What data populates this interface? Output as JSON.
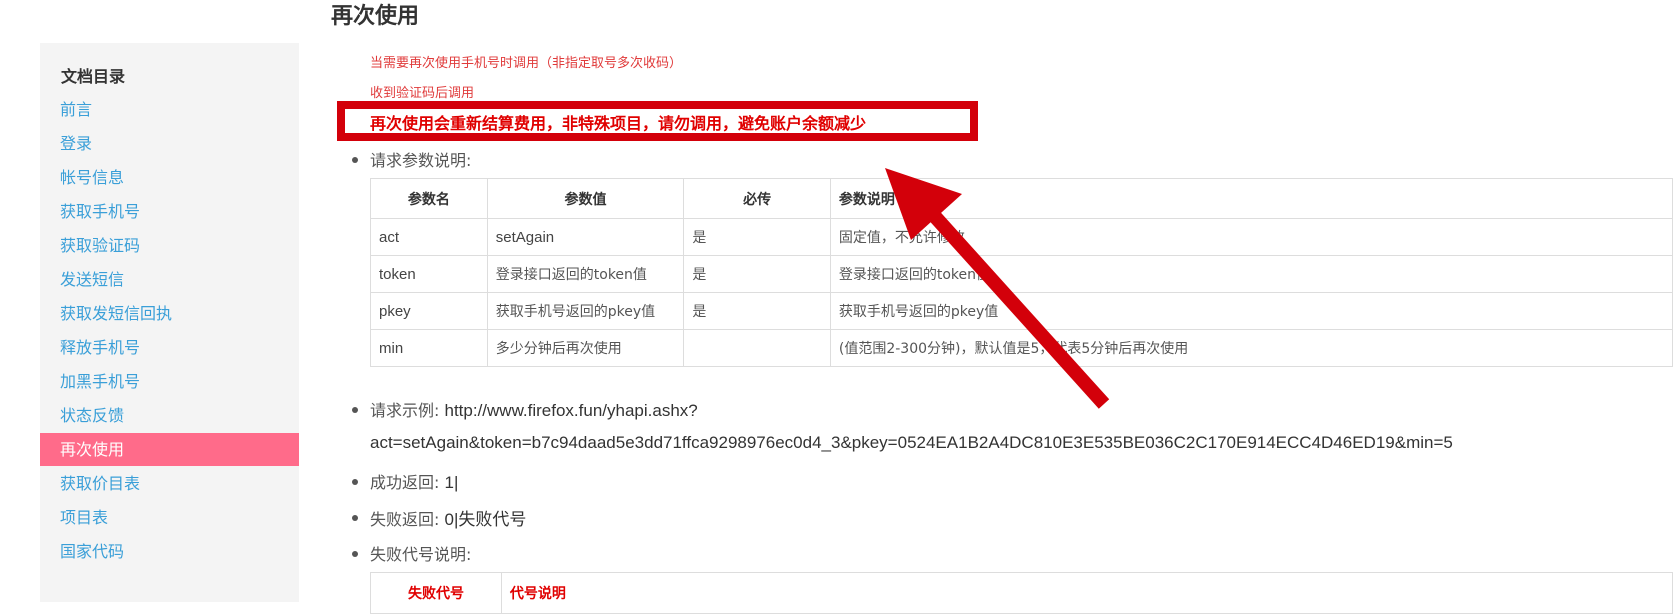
{
  "page": {
    "title": "再次使用"
  },
  "sidebar": {
    "title": "文档目录",
    "items": [
      {
        "label": "前言"
      },
      {
        "label": "登录"
      },
      {
        "label": "帐号信息"
      },
      {
        "label": "获取手机号"
      },
      {
        "label": "获取验证码"
      },
      {
        "label": "发送短信"
      },
      {
        "label": "获取发短信回执"
      },
      {
        "label": "释放手机号"
      },
      {
        "label": "加黑手机号"
      },
      {
        "label": "状态反馈"
      },
      {
        "label": "再次使用",
        "active": true
      },
      {
        "label": "获取价目表"
      },
      {
        "label": "项目表"
      },
      {
        "label": "国家代码"
      }
    ]
  },
  "notes": {
    "line1": "当需要再次使用手机号时调用（非指定取号多次收码）",
    "line2": "收到验证码后调用",
    "warning": "再次使用会重新结算费用，非特殊项目，请勿调用，避免账户余额减少"
  },
  "params": {
    "heading": "请求参数说明:",
    "columns": [
      "参数名",
      "参数值",
      "必传",
      "参数说明"
    ],
    "rows": [
      [
        "act",
        "setAgain",
        "是",
        "固定值，不允许修改"
      ],
      [
        "token",
        "登录接口返回的token值",
        "是",
        "登录接口返回的token值"
      ],
      [
        "pkey",
        "获取手机号返回的pkey值",
        "是",
        "获取手机号返回的pkey值"
      ],
      [
        "min",
        "多少分钟后再次使用",
        "",
        "(值范围2-300分钟)，默认值是5，代表5分钟后再次使用"
      ]
    ]
  },
  "example": {
    "label": "请求示例:",
    "url_line1": "http://www.firefox.fun/yhapi.ashx?",
    "url_line2": "act=setAgain&token=b7c94daad5e3dd71ffca9298976ec0d4_3&pkey=0524EA1B2A4DC810E3E535BE036C2C170E914ECC4D46ED19&min=5"
  },
  "success": {
    "label": "成功返回:",
    "value": "1|"
  },
  "failure": {
    "label": "失败返回:",
    "value": "0|失败代号"
  },
  "error_codes": {
    "heading": "失败代号说明:",
    "columns": [
      "失败代号",
      "代号说明"
    ]
  },
  "colors": {
    "accent": "#ff6b8a",
    "link": "#3a9fd8",
    "warning_border": "#d3000a",
    "warning_text": "#e00000",
    "arrow": "#d3000a"
  }
}
